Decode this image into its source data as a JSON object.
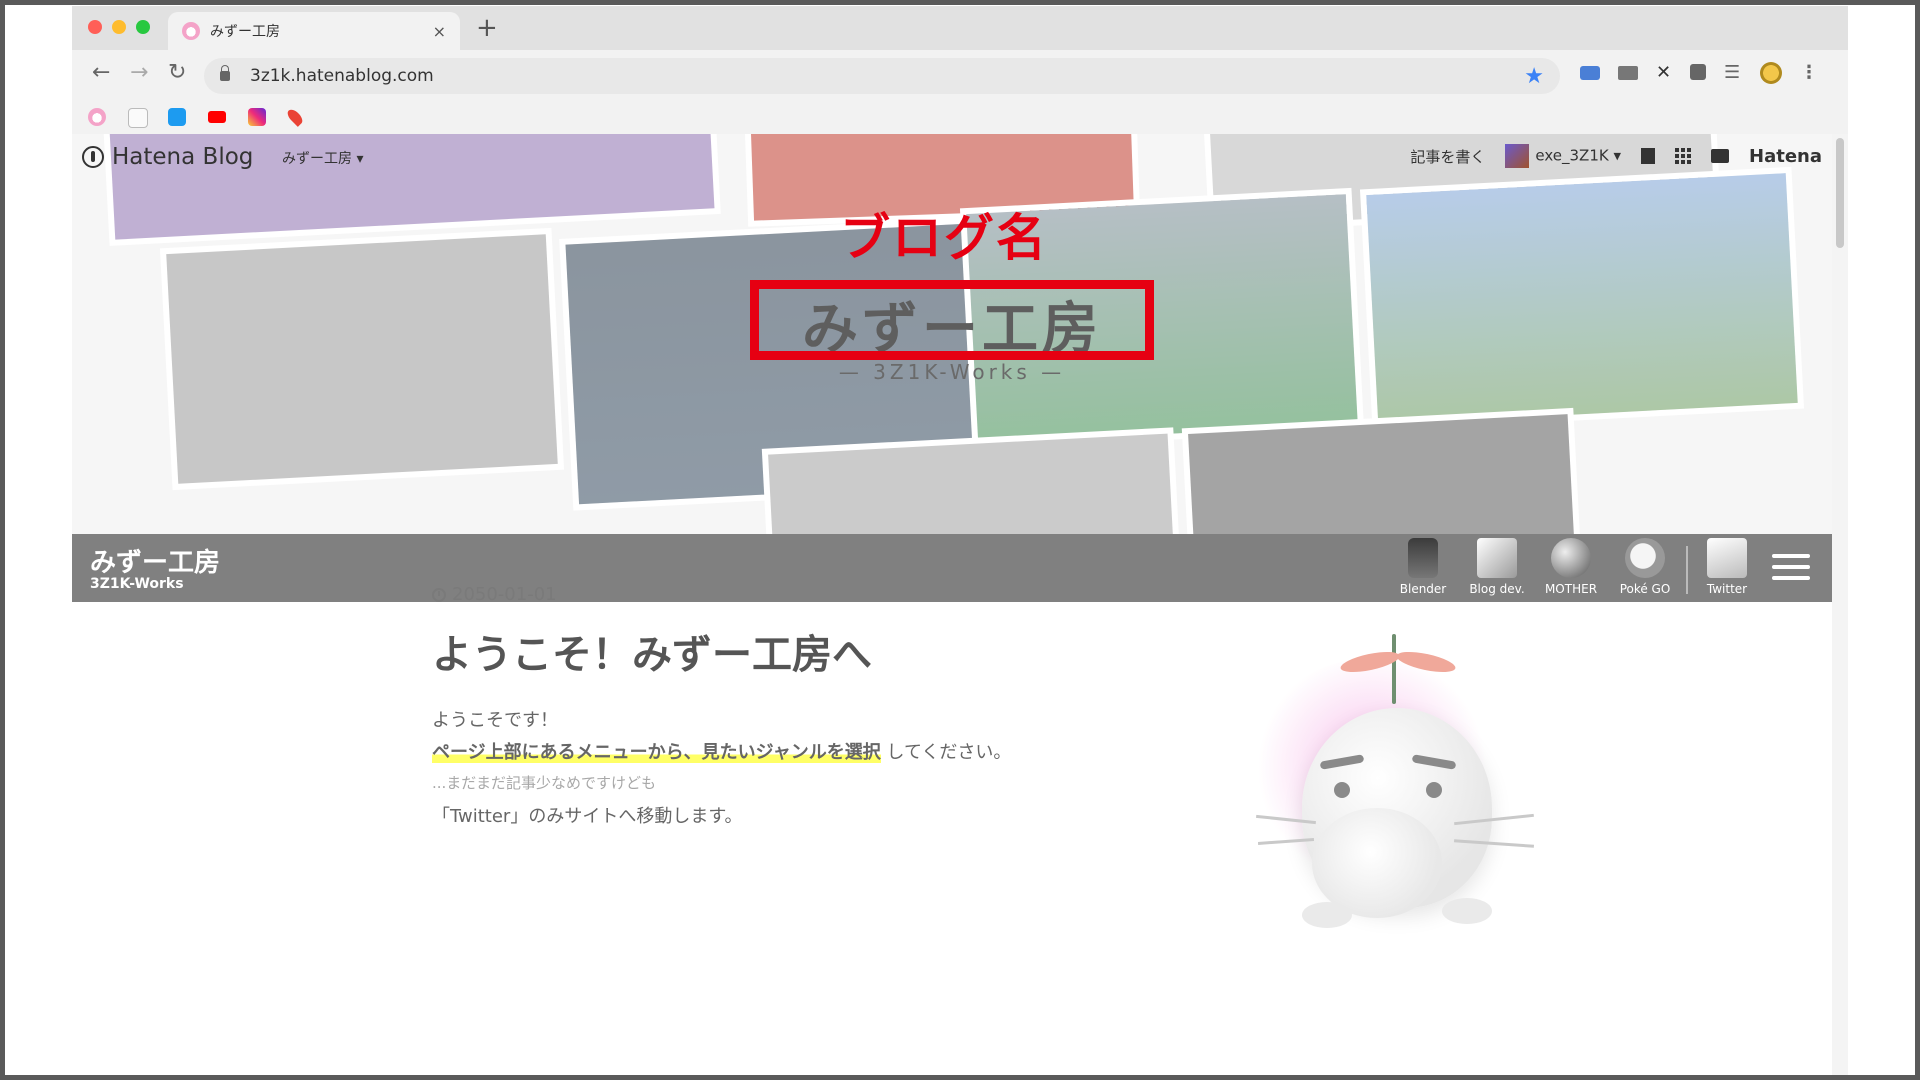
{
  "browser": {
    "tab_title": "みずー工房",
    "tab_close": "×",
    "new_tab": "+",
    "url": "3z1k.hatenablog.com",
    "nav": {
      "back": "←",
      "forward": "→",
      "reload": "↻"
    },
    "star": "★",
    "extensions": [
      "chat-icon",
      "mail-icon",
      "close-x-icon",
      "puzzle-icon",
      "playlist-icon",
      "profile-icon",
      "menu-dots-icon"
    ],
    "bookmark_icons": [
      "favicon-icon",
      "file-icon",
      "twitter-icon",
      "youtube-icon",
      "instagram-icon",
      "maps-pin-icon"
    ]
  },
  "hatena_bar": {
    "logo": "Hatena Blog",
    "blog_menu": "みずー工房 ▾",
    "write": "記事を書く",
    "user": "exe_3Z1K ▾",
    "hatena": "Hatena"
  },
  "annotation": {
    "label": "ブログ名"
  },
  "hero": {
    "title": "みずー工房",
    "subtitle": "— 3Z1K-Works —"
  },
  "global_bar": {
    "title": "みずー工房",
    "subtitle": "3Z1K-Works",
    "nav": [
      {
        "label": "Blender"
      },
      {
        "label": "Blog dev."
      },
      {
        "label": "MOTHER"
      },
      {
        "label": "Poké GO"
      },
      {
        "label": "Twitter"
      }
    ]
  },
  "article": {
    "date": "2050-01-01",
    "title": "ようこそ！みずー工房へ",
    "p1": "ようこそです！",
    "p2_highlight": "ページ上部にあるメニューから、見たいジャンルを選択",
    "p2_rest": "してください。",
    "p3": "...まだまだ記事少なめですけども",
    "p4": "「Twitter」のみサイトへ移動します。"
  },
  "colors": {
    "annotation_red": "#e60012",
    "highlight_yellow": "#ffff66",
    "bar_gray": "#808080"
  }
}
